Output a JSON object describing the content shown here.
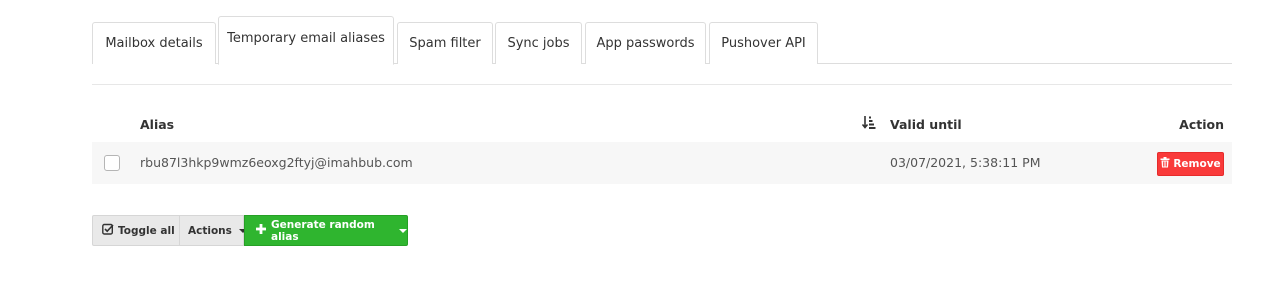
{
  "tabs": [
    {
      "label": "Mailbox details"
    },
    {
      "label": "Temporary email aliases"
    },
    {
      "label": "Spam filter"
    },
    {
      "label": "Sync jobs"
    },
    {
      "label": "App passwords"
    },
    {
      "label": "Pushover API"
    }
  ],
  "table": {
    "columns": {
      "alias": "Alias",
      "valid_until": "Valid until",
      "action": "Action"
    },
    "sort_icon": "sort-amount-desc-icon",
    "rows": [
      {
        "alias": "rbu87l3hkp9wmz6eoxg2ftyj@imahbub.com",
        "valid_until": "03/07/2021, 5:38:11 PM",
        "action_label": "Remove"
      }
    ]
  },
  "toolbar": {
    "toggle_all": "Toggle all",
    "actions": "Actions",
    "generate": "Generate random alias"
  },
  "colors": {
    "danger": "#f93a3a",
    "success": "#2fb52f"
  }
}
